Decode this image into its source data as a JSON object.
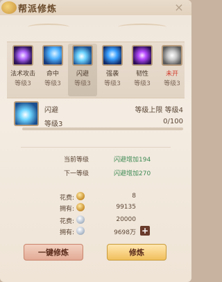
{
  "window": {
    "title": "帮派修炼",
    "close_icon": "×"
  },
  "skills": [
    {
      "name": "法术攻击",
      "level": "等级3",
      "icon": "purple-magic-icon",
      "selected": false,
      "locked": false
    },
    {
      "name": "命中",
      "level": "等级3",
      "icon": "blue-wave-icon",
      "selected": false,
      "locked": false
    },
    {
      "name": "闪避",
      "level": "等级3",
      "icon": "blue-dash-icon",
      "selected": true,
      "locked": false
    },
    {
      "name": "强袭",
      "level": "等级3",
      "icon": "blue-lightning-icon",
      "selected": false,
      "locked": false
    },
    {
      "name": "韧性",
      "level": "等级3",
      "icon": "purple-storm-icon",
      "selected": false,
      "locked": false
    },
    {
      "name": "未开",
      "level": "等级3",
      "icon": "grey-locked-icon",
      "selected": false,
      "locked": true
    }
  ],
  "detail": {
    "name": "闪避",
    "cap_label": "等级上限",
    "cap_value": "等级4",
    "level": "等级3",
    "progress_text": "0/100",
    "progress_fraction": 0.0
  },
  "stats": {
    "current_label": "当前等级",
    "current_value": "闪避增加194",
    "next_label": "下一等级",
    "next_value": "闪避增加270"
  },
  "costs": [
    {
      "label": "花费:",
      "currency": "gold-coin-icon",
      "value": "8"
    },
    {
      "label": "拥有:",
      "currency": "gold-coin-icon",
      "value": "99135"
    },
    {
      "label": "花费:",
      "currency": "silver-coin-icon",
      "value": "20000"
    },
    {
      "label": "拥有:",
      "currency": "silver-coin-icon",
      "value": "9698万"
    }
  ],
  "buttons": {
    "oneclick": "一键修炼",
    "train": "修炼",
    "plus": "+"
  },
  "colors": {
    "accent_green": "#3e8b55",
    "locked_red": "#d23a2a"
  }
}
